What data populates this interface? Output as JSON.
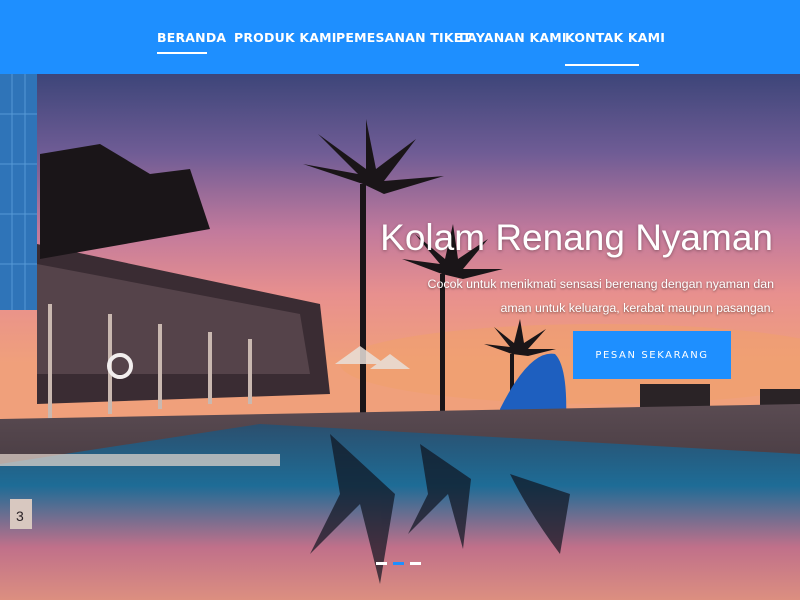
{
  "nav": {
    "items": [
      {
        "label": "BERANDA"
      },
      {
        "label": "PRODUK KAMI"
      },
      {
        "label": "PEMESANAN TIKET"
      },
      {
        "label": "LAYANAN KAMI"
      },
      {
        "label": "KONTAK KAMI"
      }
    ]
  },
  "hero": {
    "title": "Kolam Renang Nyaman",
    "description": "Cocok untuk menikmati sensasi berenang dengan nyaman dan aman untuk keluarga, kerabat maupun pasangan.",
    "cta_label": "PESAN SEKARANG"
  },
  "carousel": {
    "slide_count": 3,
    "active_index": 1
  },
  "colors": {
    "primary": "#1e8fff",
    "text_light": "#ffffff"
  }
}
